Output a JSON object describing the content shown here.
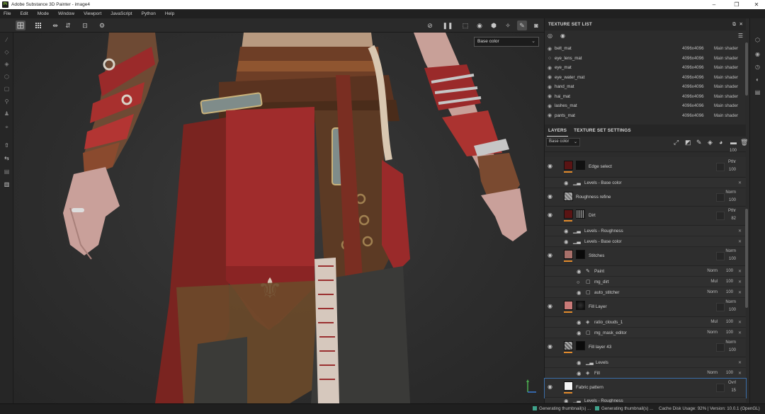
{
  "window": {
    "title": "Adobe Substance 3D Painter - image4",
    "app_icon": "Pt",
    "controls": [
      "–",
      "❐",
      "✕"
    ]
  },
  "menu": [
    "File",
    "Edit",
    "Mode",
    "Window",
    "Viewport",
    "JavaScript",
    "Python",
    "Help"
  ],
  "viewport": {
    "channel": "Base color"
  },
  "texture_set_list": {
    "title": "TEXTURE SET LIST",
    "rows": [
      {
        "name": "belt_mat",
        "res": "4096x4096",
        "shader": "Main shader"
      },
      {
        "name": "eye_lens_mat",
        "res": "4096x4096",
        "shader": "Main shader"
      },
      {
        "name": "eye_mat",
        "res": "4096x4096",
        "shader": "Main shader"
      },
      {
        "name": "eye_water_mat",
        "res": "4096x4096",
        "shader": "Main shader"
      },
      {
        "name": "hand_mat",
        "res": "4096x4096",
        "shader": "Main shader"
      },
      {
        "name": "hai_mat",
        "res": "4096x4096",
        "shader": "Main shader"
      },
      {
        "name": "lashes_mat",
        "res": "4096x4096",
        "shader": "Main shader"
      },
      {
        "name": "pants_mat",
        "res": "4096x4096",
        "shader": "Main shader"
      }
    ]
  },
  "layers_panel": {
    "tabs": [
      "LAYERS",
      "TEXTURE SET SETTINGS"
    ],
    "channel": "Base color",
    "top_value": "100",
    "layers": [
      {
        "name": "Edge select",
        "blend": "Pthr",
        "opacity": "100"
      },
      {
        "name": "Roughness refine",
        "blend": "Norm",
        "opacity": "100"
      },
      {
        "name": "Dirt",
        "blend": "Pthr",
        "opacity": "82"
      },
      {
        "name": "Stitches",
        "blend": "Norm",
        "opacity": "100"
      },
      {
        "name": "Fill Layer",
        "blend": "Norm",
        "opacity": "100"
      },
      {
        "name": "Fill layer 43",
        "blend": "Norm",
        "opacity": "100"
      },
      {
        "name": "Fabric pattern",
        "blend": "Ovrl",
        "opacity": "15"
      }
    ],
    "sublayers": {
      "edge_levels": "Levels - Base color",
      "dirt_levels1": "Levels - Roughness",
      "dirt_levels2": "Levels - Base color",
      "paint": {
        "name": "Paint",
        "mode": "Norm",
        "opacity": "100"
      },
      "mg_dirt": {
        "name": "mg_dirt",
        "mode": "Mul",
        "opacity": "100"
      },
      "auto_stitcher": {
        "name": "auto_stitcher",
        "mode": "Norm",
        "opacity": "100"
      },
      "ratio_clouds": {
        "name": "ratio_clouds_1",
        "mode": "Mul",
        "opacity": "100"
      },
      "mg_mask_editor": {
        "name": "mg_mask_editor",
        "mode": "Norm",
        "opacity": "100"
      },
      "levels": "Levels",
      "fill": {
        "name": "Fill",
        "mode": "Norm",
        "opacity": "100"
      },
      "fabric_levels": "Levels - Roughness"
    }
  },
  "status": {
    "gen1": "Generating thumbnail(s) ...",
    "gen2": "Generating thumbnail(s) ...",
    "cache": "Cache Disk Usage:",
    "cache_pct": "92%",
    "version": "Version: 10.0.1 (OpenGL)"
  }
}
